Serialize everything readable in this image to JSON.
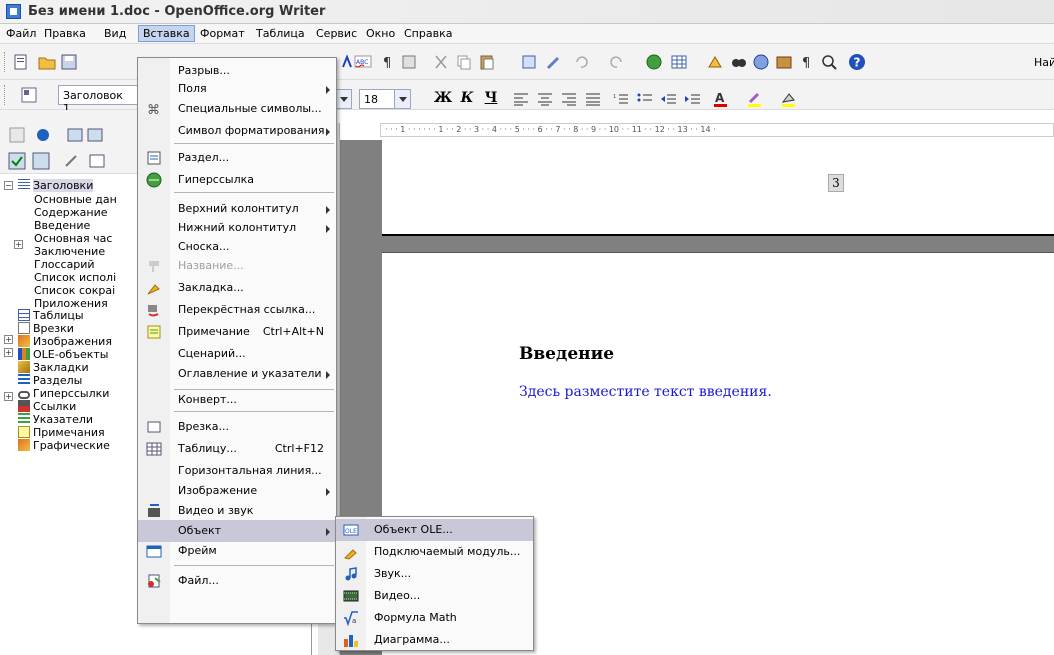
{
  "window": {
    "title": "Без имени 1.doc - OpenOffice.org Writer"
  },
  "menubar": {
    "items": [
      {
        "label": "Файл"
      },
      {
        "label": "Правка"
      },
      {
        "label": "Вид"
      },
      {
        "label": "Вставка"
      },
      {
        "label": "Формат"
      },
      {
        "label": "Таблица"
      },
      {
        "label": "Сервис"
      },
      {
        "label": "Окно"
      },
      {
        "label": "Справка"
      }
    ]
  },
  "toolbar": {
    "find_label": "Най"
  },
  "formatting": {
    "paragraph_style": "Заголовок 1",
    "font_size": "18",
    "bold": "Ж",
    "italic": "К",
    "underline": "Ч"
  },
  "navigator": {
    "tree": [
      {
        "label": "Заголовки",
        "selected": true
      },
      {
        "label": "Основные дан"
      },
      {
        "label": "Содержание"
      },
      {
        "label": "Введение"
      },
      {
        "label": "Основная час"
      },
      {
        "label": "Заключение"
      },
      {
        "label": "Глоссарий"
      },
      {
        "label": "Список исполі"
      },
      {
        "label": "Список сокраі"
      },
      {
        "label": "Приложения"
      },
      {
        "label": "Таблицы"
      },
      {
        "label": "Врезки"
      },
      {
        "label": "Изображения"
      },
      {
        "label": "OLE-объекты"
      },
      {
        "label": "Закладки"
      },
      {
        "label": "Разделы"
      },
      {
        "label": "Гиперссылки"
      },
      {
        "label": "Ссылки"
      },
      {
        "label": "Указатели"
      },
      {
        "label": "Примечания"
      },
      {
        "label": "Графические"
      }
    ]
  },
  "ruler": {
    "marks": "· · · 1 · · · · · · 1 · · 2 · · 3 · · 4 · · · 5 · · · 6 · · 7 · · 8 · · 9 · · 10 · · 11 · · 12 · · 13 · · 14 ·"
  },
  "document": {
    "page_number": "3",
    "heading": "Введение",
    "body": "Здесь разместите текст введения."
  },
  "insert_menu": {
    "items": [
      {
        "label": "Разрыв..."
      },
      {
        "label": "Поля",
        "submenu": true
      },
      {
        "label": "Специальные символы..."
      },
      {
        "label": "Символ форматирования",
        "submenu": true
      },
      {
        "label": "Раздел..."
      },
      {
        "label": "Гиперссылка"
      },
      {
        "label": "Верхний колонтитул",
        "submenu": true
      },
      {
        "label": "Нижний колонтитул",
        "submenu": true
      },
      {
        "label": "Сноска..."
      },
      {
        "label": "Название...",
        "disabled": true
      },
      {
        "label": "Закладка..."
      },
      {
        "label": "Перекрёстная ссылка..."
      },
      {
        "label": "Примечание",
        "shortcut": "Ctrl+Alt+N"
      },
      {
        "label": "Сценарий..."
      },
      {
        "label": "Оглавление и указатели",
        "submenu": true
      },
      {
        "label": "Конверт..."
      },
      {
        "label": "Врезка..."
      },
      {
        "label": "Таблицу...",
        "shortcut": "Ctrl+F12"
      },
      {
        "label": "Горизонтальная линия..."
      },
      {
        "label": "Изображение",
        "submenu": true
      },
      {
        "label": "Видео и звук"
      },
      {
        "label": "Объект",
        "submenu": true,
        "highlighted": true
      },
      {
        "label": "Фрейм"
      },
      {
        "label": "Файл..."
      }
    ]
  },
  "object_submenu": {
    "items": [
      {
        "label": "Объект OLE...",
        "highlighted": true
      },
      {
        "label": "Подключаемый модуль..."
      },
      {
        "label": "Звук..."
      },
      {
        "label": "Видео..."
      },
      {
        "label": "Формула Math"
      },
      {
        "label": "Диаграмма..."
      }
    ]
  },
  "colors": {
    "menu_highlight": "#c8c8d8",
    "doc_body_text": "#1a1ad0"
  }
}
